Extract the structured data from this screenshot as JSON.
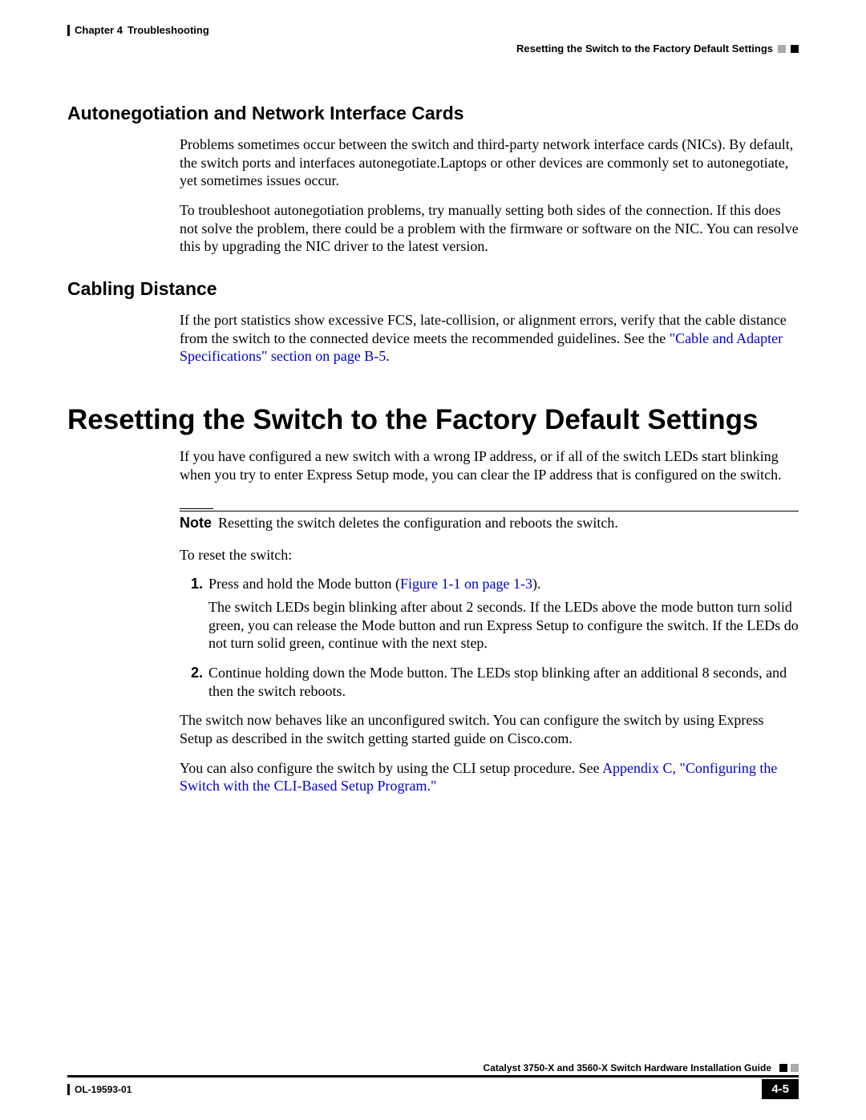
{
  "header": {
    "chapter": "Chapter 4",
    "chapter_title": "Troubleshooting",
    "section_right": "Resetting the Switch to the Factory Default Settings"
  },
  "sec1": {
    "heading": "Autonegotiation and Network Interface Cards",
    "p1": "Problems sometimes occur between the switch and third-party network interface cards (NICs). By default, the switch ports and interfaces autonegotiate.Laptops or other devices are commonly set to autonegotiate, yet sometimes issues occur.",
    "p2": "To troubleshoot autonegotiation problems, try manually setting both sides of the connection. If this does not solve the problem, there could be a problem with the firmware or software on the NIC. You can resolve this by upgrading the NIC driver to the latest version."
  },
  "sec2": {
    "heading": "Cabling Distance",
    "p1a": "If the port statistics show excessive FCS, late-collision, or alignment errors, verify that the cable distance from the switch to the connected device meets the recommended guidelines. See the ",
    "link1": "\"Cable and Adapter Specifications\" section on page B-5",
    "p1b": "."
  },
  "main": {
    "heading": "Resetting the Switch to the Factory Default Settings",
    "p1": "If you have configured a new switch with a wrong IP address, or if all of the switch LEDs start blinking when you try to enter Express Setup mode, you can clear the IP address that is configured on the switch.",
    "note_label": "Note",
    "note_text": "Resetting the switch deletes the configuration and reboots the switch.",
    "p2": "To reset the switch:",
    "step1a": "Press and hold the Mode button (",
    "step1_link": "Figure 1-1 on page 1-3",
    "step1b": ").",
    "step1_sub": "The switch LEDs begin blinking after about 2 seconds. If the LEDs above the mode button turn solid green, you can release the Mode button and run Express Setup to configure the switch. If the LEDs do not turn solid green, continue with the next step.",
    "step2": "Continue holding down the Mode button. The LEDs stop blinking after an additional 8 seconds, and then the switch reboots.",
    "p3": "The switch now behaves like an unconfigured switch. You can configure the switch by using Express Setup as described in the switch getting started guide on Cisco.com.",
    "p4a": "You can also configure the switch by using the CLI setup procedure. See ",
    "p4_link": "Appendix C, \"Configuring the Switch with the CLI-Based Setup Program.\""
  },
  "footer": {
    "guide": "Catalyst 3750-X and 3560-X Switch Hardware Installation Guide",
    "doc": "OL-19593-01",
    "page": "4-5"
  }
}
